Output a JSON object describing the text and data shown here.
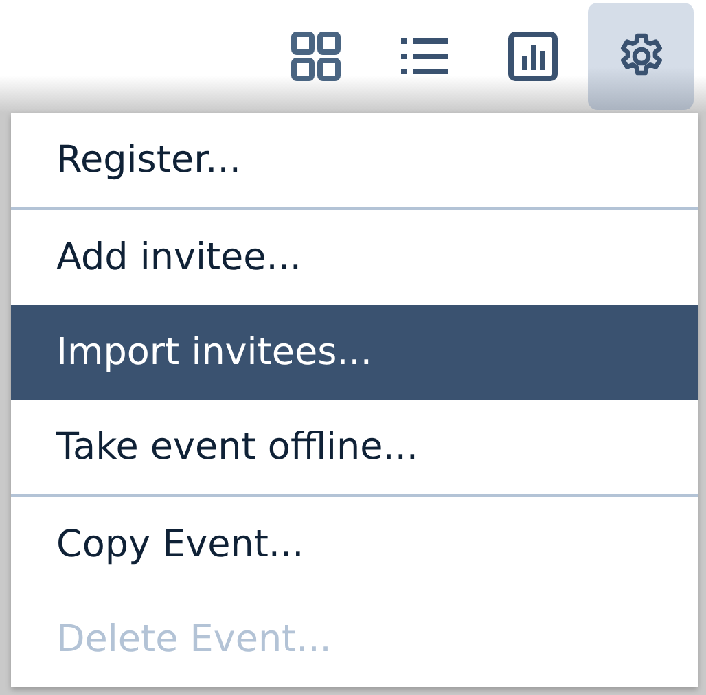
{
  "toolbar": {
    "buttons": [
      {
        "kind": "grid",
        "selected": false
      },
      {
        "kind": "list",
        "selected": false
      },
      {
        "kind": "chart",
        "selected": false
      },
      {
        "kind": "settings",
        "selected": true
      }
    ]
  },
  "menu": {
    "items": [
      {
        "label": "Register...",
        "selected": false,
        "disabled": false,
        "divider_after": true
      },
      {
        "label": "Add invitee...",
        "selected": false,
        "disabled": false,
        "divider_after": false
      },
      {
        "label": "Import invitees...",
        "selected": true,
        "disabled": false,
        "divider_after": false
      },
      {
        "label": "Take event offline...",
        "selected": false,
        "disabled": false,
        "divider_after": true
      },
      {
        "label": "Copy Event...",
        "selected": false,
        "disabled": false,
        "divider_after": false
      },
      {
        "label": "Delete Event...",
        "selected": false,
        "disabled": true,
        "divider_after": false
      }
    ]
  }
}
